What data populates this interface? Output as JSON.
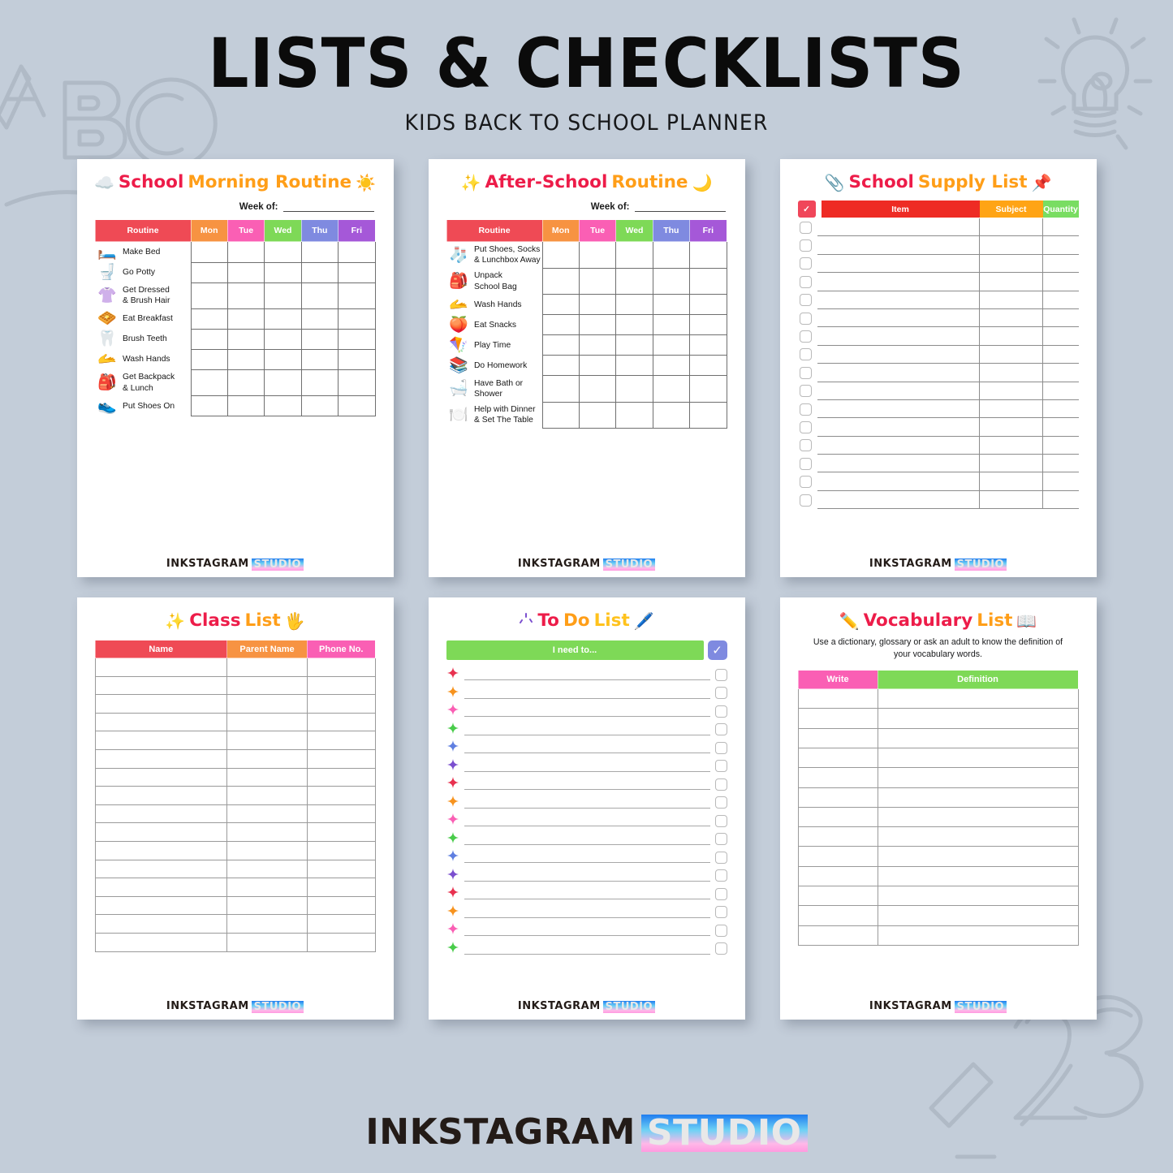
{
  "header": {
    "title": "LISTS & CHECKLISTS",
    "subtitle": "KIDS BACK TO SCHOOL PLANNER"
  },
  "brand": {
    "name": "INKSTAGRAM",
    "suffix": "STUDIO"
  },
  "colors": {
    "background": "#c3cdd9",
    "title_red": "#ed1c49",
    "title_orange": "#ff9e18",
    "title_yellow": "#ffc21c",
    "header_red": "#ef4a55",
    "header_orange": "#f79342",
    "header_pink": "#fa5fb4",
    "header_green": "#7ed957",
    "header_blue": "#7f8ae0",
    "header_purple": "#a558d8"
  },
  "morning": {
    "title_part1": "School",
    "title_part2": "Morning Routine",
    "icon_left": "cloud-icon",
    "icon_left_glyph": "☁️",
    "icon_right": "sun-icon",
    "icon_right_glyph": "☀️",
    "week_label": "Week of:",
    "week_value": "",
    "columns": [
      "Routine",
      "Mon",
      "Tue",
      "Wed",
      "Thu",
      "Fri"
    ],
    "rows": [
      {
        "emoji": "🛏️",
        "icon": "bed-icon",
        "label": "Make Bed"
      },
      {
        "emoji": "🚽",
        "icon": "toilet-icon",
        "label": "Go Potty"
      },
      {
        "emoji": "👚",
        "icon": "clothes-comb-icon",
        "label": "Get Dressed\n& Brush Hair"
      },
      {
        "emoji": "🧇",
        "icon": "waffle-icon",
        "label": "Eat Breakfast"
      },
      {
        "emoji": "🦷",
        "icon": "tooth-icon",
        "label": "Brush Teeth"
      },
      {
        "emoji": "🫴",
        "icon": "wash-hands-icon",
        "label": "Wash Hands"
      },
      {
        "emoji": "🎒",
        "icon": "backpack-icon",
        "label": "Get Backpack\n& Lunch"
      },
      {
        "emoji": "👟",
        "icon": "shoes-icon",
        "label": "Put Shoes On"
      }
    ]
  },
  "afterschool": {
    "title_part1": "After-School",
    "title_part2": "Routine",
    "icon_left": "sparkles-icon",
    "icon_left_glyph": "✨",
    "icon_right": "moon-icon",
    "icon_right_glyph": "🌙",
    "week_label": "Week of:",
    "week_value": "",
    "columns": [
      "Routine",
      "Mon",
      "Tue",
      "Wed",
      "Thu",
      "Fri"
    ],
    "rows": [
      {
        "emoji": "🧦",
        "icon": "socks-icon",
        "label": "Put Shoes, Socks\n& Lunchbox Away"
      },
      {
        "emoji": "🎒",
        "icon": "backpack-icon",
        "label": "Unpack\nSchool Bag"
      },
      {
        "emoji": "🫴",
        "icon": "wash-hands-icon",
        "label": "Wash Hands"
      },
      {
        "emoji": "🍑",
        "icon": "fruit-icon",
        "label": "Eat Snacks"
      },
      {
        "emoji": "🪁",
        "icon": "play-icon",
        "label": "Play Time"
      },
      {
        "emoji": "📚",
        "icon": "homework-icon",
        "label": "Do Homework"
      },
      {
        "emoji": "🛁",
        "icon": "bathtub-icon",
        "label": "Have Bath or\nShower"
      },
      {
        "emoji": "🍽️",
        "icon": "plate-icon",
        "label": "Help with Dinner\n& Set The Table"
      }
    ]
  },
  "supply": {
    "title_part1": "School",
    "title_part2": "Supply List",
    "icon_left": "paperclip-icon",
    "icon_left_glyph": "📎",
    "icon_right": "pushpin-icon",
    "icon_right_glyph": "📌",
    "header_check": "✓",
    "columns": [
      "Item",
      "Subject",
      "Quantity"
    ],
    "row_count": 16
  },
  "classlist": {
    "title_part1": "Class",
    "title_part2": "List",
    "icon_left": "stars-icon",
    "icon_left_glyph": "✨",
    "icon_right": "hand-icon",
    "icon_right_glyph": "🖐️",
    "columns": [
      "Name",
      "Parent Name",
      "Phone No."
    ],
    "row_count": 16
  },
  "todo": {
    "title_part1": "To",
    "title_part2": "Do",
    "title_part3": "List",
    "icon_left": "sparkle-burst-icon",
    "icon_right": "pen-icon",
    "icon_right_glyph": "🖊️",
    "bar_label": "I need to...",
    "header_check": "✓",
    "row_count": 16,
    "star_colors": [
      "#e8314f",
      "#f7931e",
      "#fa5fb4",
      "#49cc4a",
      "#5f7fe0",
      "#7b4fcf"
    ]
  },
  "vocabulary": {
    "title_part1": "Vocabulary",
    "title_part2": "List",
    "icon_left": "pencil-icon",
    "icon_left_glyph": "✏️",
    "icon_right": "dictionary-icon",
    "icon_right_glyph": "📖",
    "note": "Use a dictionary, glossary or ask an adult to know the definition of your vocabulary words.",
    "columns": [
      "Write",
      "Definition"
    ],
    "row_count": 13
  }
}
